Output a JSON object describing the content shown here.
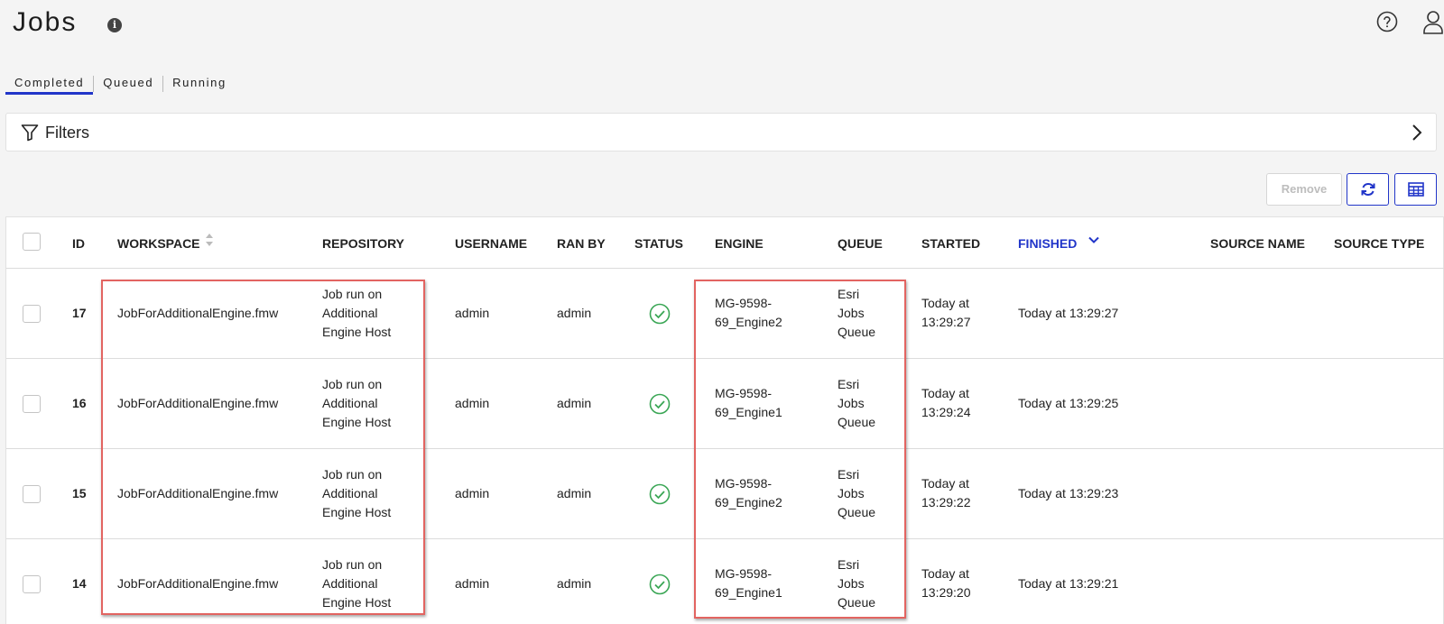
{
  "page": {
    "title": "Jobs"
  },
  "tabs": [
    {
      "label": "Completed",
      "active": true
    },
    {
      "label": "Queued",
      "active": false
    },
    {
      "label": "Running",
      "active": false
    }
  ],
  "filters": {
    "label": "Filters"
  },
  "toolbar": {
    "remove_label": "Remove"
  },
  "table": {
    "columns": [
      "ID",
      "WORKSPACE",
      "REPOSITORY",
      "USERNAME",
      "RAN BY",
      "STATUS",
      "ENGINE",
      "QUEUE",
      "STARTED",
      "FINISHED",
      "SOURCE NAME",
      "SOURCE TYPE"
    ],
    "sorted_column": "FINISHED",
    "sort_direction": "descending",
    "rows": [
      {
        "id": "17",
        "workspace": "JobForAdditionalEngine.fmw",
        "repository": [
          "Job run on",
          "Additional",
          "Engine Host"
        ],
        "username": "admin",
        "ran_by": "admin",
        "status": "success",
        "engine": [
          "MG-9598-",
          "69_Engine2"
        ],
        "queue": [
          "Esri",
          "Jobs",
          "Queue"
        ],
        "started": [
          "Today at",
          "13:29:27"
        ],
        "finished": "Today at 13:29:27"
      },
      {
        "id": "16",
        "workspace": "JobForAdditionalEngine.fmw",
        "repository": [
          "Job run on",
          "Additional",
          "Engine Host"
        ],
        "username": "admin",
        "ran_by": "admin",
        "status": "success",
        "engine": [
          "MG-9598-",
          "69_Engine1"
        ],
        "queue": [
          "Esri",
          "Jobs",
          "Queue"
        ],
        "started": [
          "Today at",
          "13:29:24"
        ],
        "finished": "Today at 13:29:25"
      },
      {
        "id": "15",
        "workspace": "JobForAdditionalEngine.fmw",
        "repository": [
          "Job run on",
          "Additional",
          "Engine Host"
        ],
        "username": "admin",
        "ran_by": "admin",
        "status": "success",
        "engine": [
          "MG-9598-",
          "69_Engine2"
        ],
        "queue": [
          "Esri",
          "Jobs",
          "Queue"
        ],
        "started": [
          "Today at",
          "13:29:22"
        ],
        "finished": "Today at 13:29:23"
      },
      {
        "id": "14",
        "workspace": "JobForAdditionalEngine.fmw",
        "repository": [
          "Job run on",
          "Additional",
          "Engine Host"
        ],
        "username": "admin",
        "ran_by": "admin",
        "status": "success",
        "engine": [
          "MG-9598-",
          "69_Engine1"
        ],
        "queue": [
          "Esri",
          "Jobs",
          "Queue"
        ],
        "started": [
          "Today at",
          "13:29:20"
        ],
        "finished": "Today at 13:29:21"
      }
    ]
  },
  "colors": {
    "accent": "#2135c9",
    "success": "#3aa655",
    "annotation": "#e26461"
  },
  "icons": [
    "info-icon",
    "help-icon",
    "user-icon",
    "filter-icon",
    "chevron-right-icon",
    "refresh-icon",
    "columns-icon",
    "sort-icon",
    "chevron-down-icon",
    "check-circle-icon"
  ]
}
